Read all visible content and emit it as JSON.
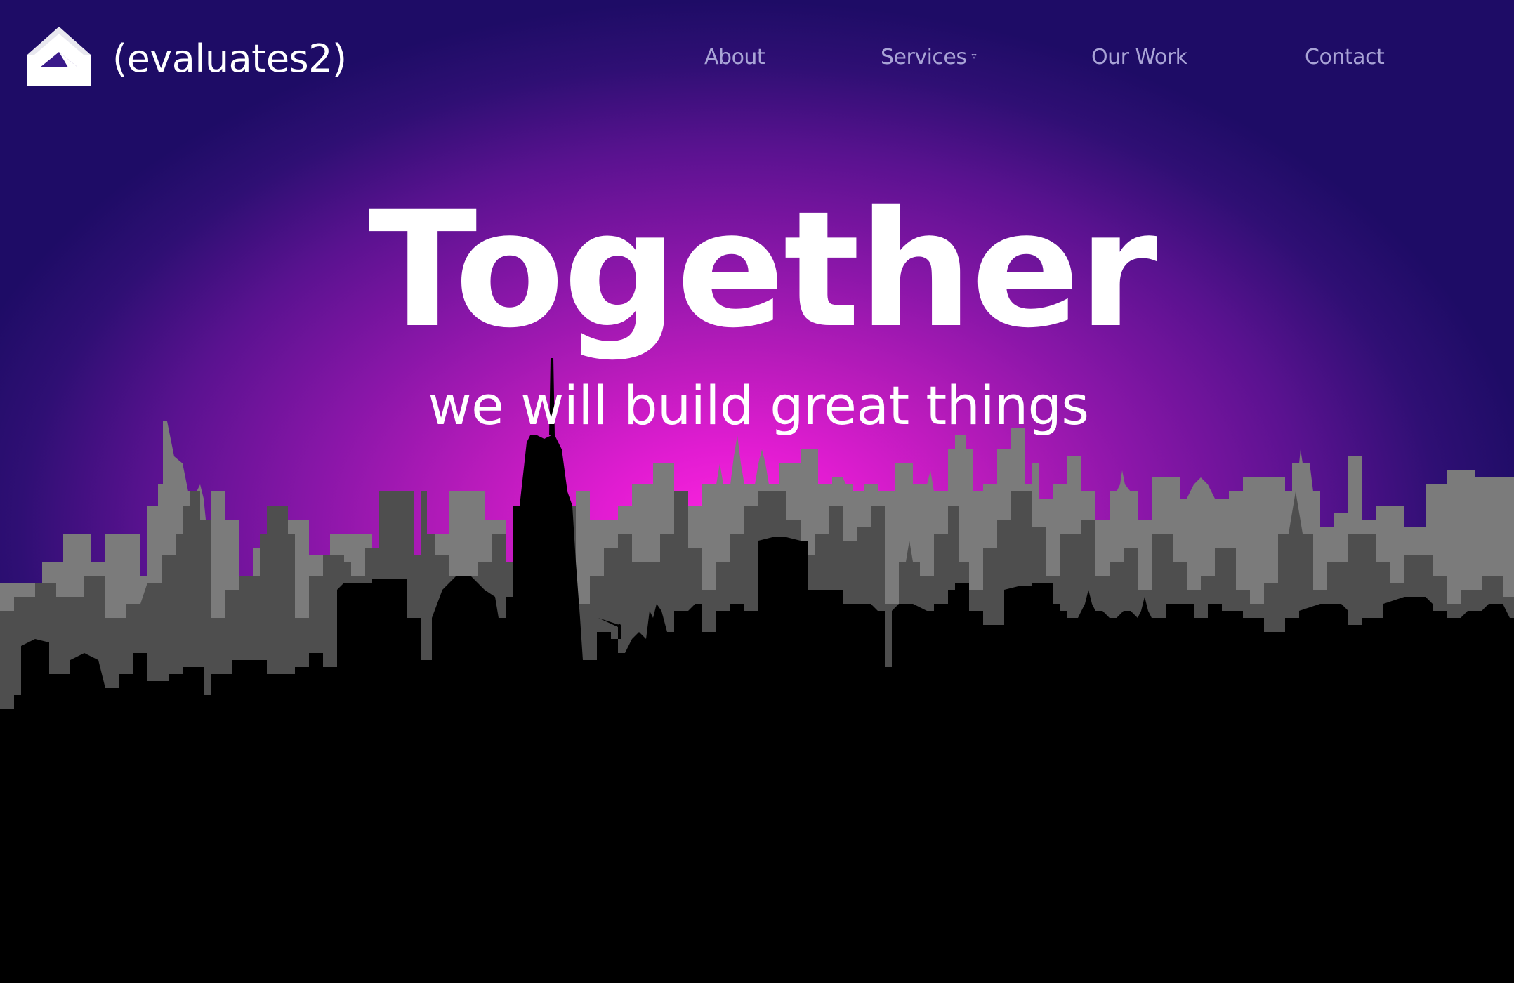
{
  "header": {
    "brand": "(evaluates2)",
    "logo_icon": "house-logo-icon",
    "nav": {
      "about": "About",
      "services": "Services",
      "services_caret": "▿",
      "our_work": "Our Work",
      "contact": "Contact"
    }
  },
  "hero": {
    "headline": "Together",
    "tagline": "we will build great things"
  },
  "colors": {
    "nav_text": "#a9a4d6",
    "sky_top": "#1e0c66",
    "sky_glow": "#ff24e0",
    "skyline_far": "#7b7b7b",
    "skyline_mid": "#4e4e4e",
    "skyline_near": "#000000"
  }
}
